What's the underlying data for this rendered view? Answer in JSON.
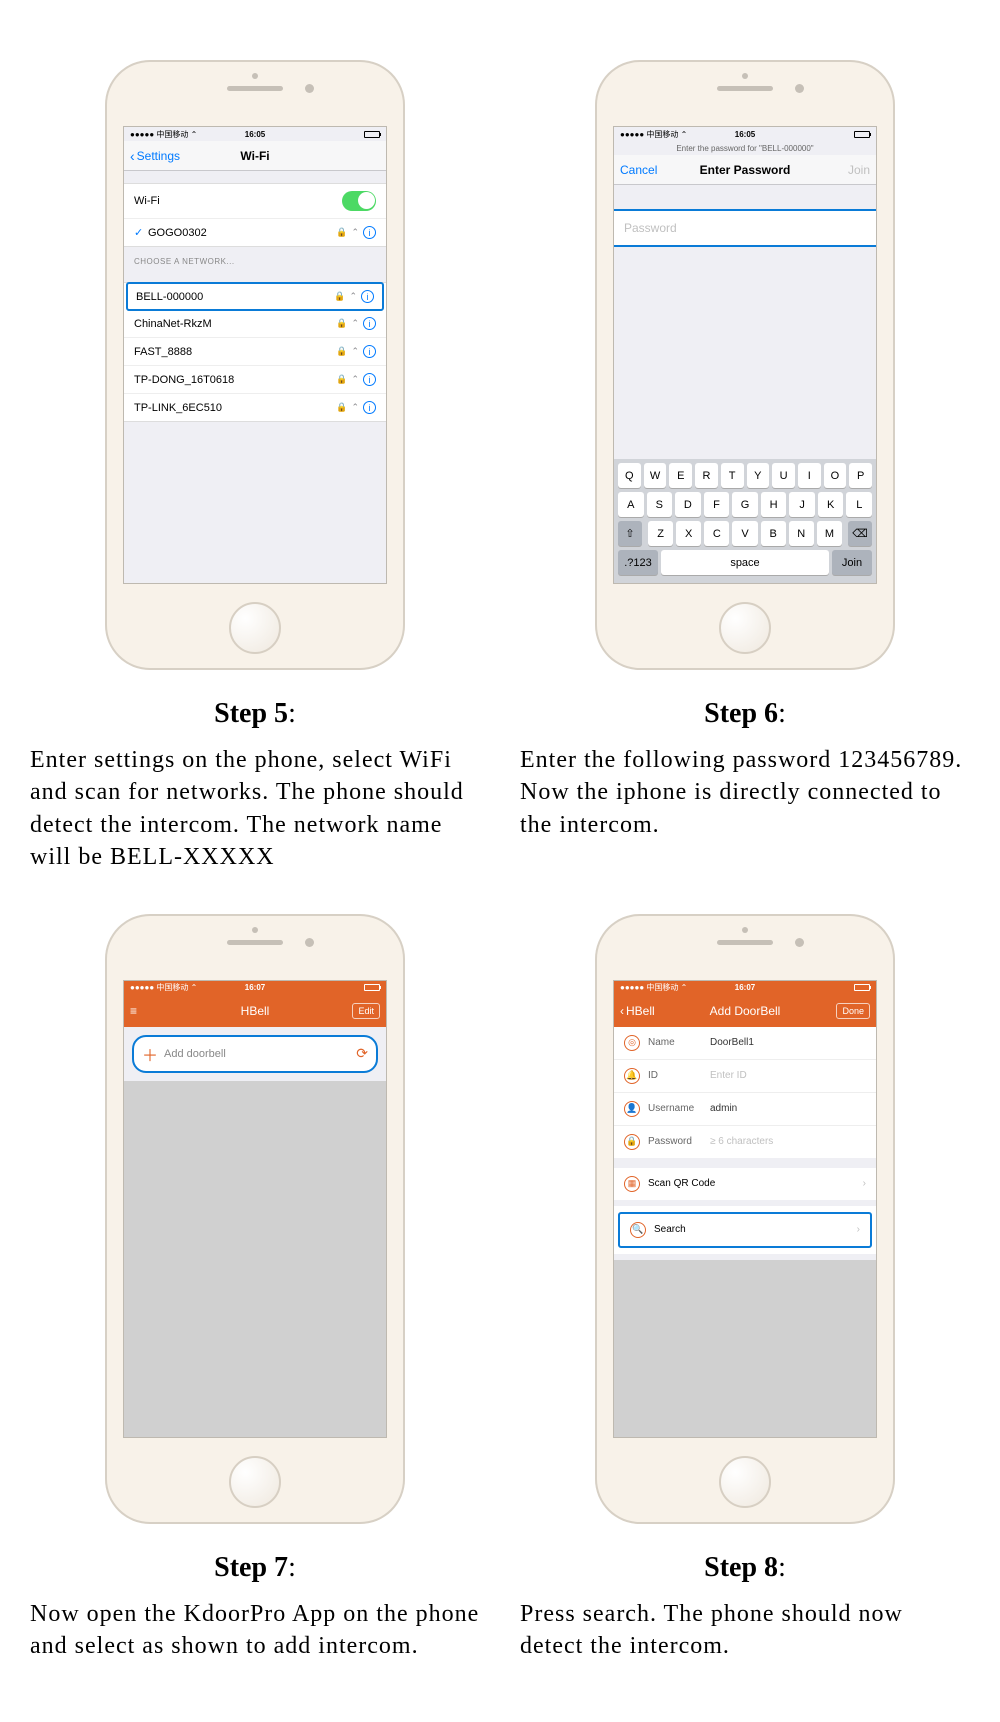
{
  "steps": {
    "s5": {
      "title": "Step 5",
      "text": "Enter settings on the phone, select WiFi and scan for networks. The phone should detect the intercom. The network name will be BELL-XXXXX"
    },
    "s6": {
      "title": "Step 6",
      "text": "Enter the following password 123456789. Now the iphone is directly connected to the intercom."
    },
    "s7": {
      "title": "Step 7",
      "text": "Now open the KdoorPro App on the phone and select as shown to add intercom."
    },
    "s8": {
      "title": "Step 8",
      "text": "Press search. The phone should now detect the intercom."
    }
  },
  "phone5": {
    "carrier": "●●●●● 中国移动 ⌃",
    "time": "16:05",
    "back": "Settings",
    "title": "Wi-Fi",
    "wifi_label": "Wi-Fi",
    "connected": "GOGO0302",
    "choose": "CHOOSE A NETWORK...",
    "nets": [
      "BELL-000000",
      "ChinaNet-RkzM",
      "FAST_8888",
      "TP-DONG_16T0618",
      "TP-LINK_6EC510"
    ]
  },
  "phone6": {
    "carrier": "●●●●● 中国移动 ⌃",
    "time": "16:05",
    "sub": "Enter the password for \"BELL-000000\"",
    "cancel": "Cancel",
    "title": "Enter Password",
    "join": "Join",
    "placeholder": "Password",
    "row1": [
      "Q",
      "W",
      "E",
      "R",
      "T",
      "Y",
      "U",
      "I",
      "O",
      "P"
    ],
    "row2": [
      "A",
      "S",
      "D",
      "F",
      "G",
      "H",
      "J",
      "K",
      "L"
    ],
    "row3": [
      "Z",
      "X",
      "C",
      "V",
      "B",
      "N",
      "M"
    ],
    "numkey": ".?123",
    "space": "space",
    "joinkey": "Join"
  },
  "phone7": {
    "carrier": "●●●●● 中国移动 ⌃",
    "time": "16:07",
    "title": "HBell",
    "edit": "Edit",
    "add": "Add doorbell"
  },
  "phone8": {
    "carrier": "●●●●● 中国移动 ⌃",
    "time": "16:07",
    "back": "HBell",
    "title": "Add DoorBell",
    "done": "Done",
    "f_name": "Name",
    "v_name": "DoorBell1",
    "f_id": "ID",
    "v_id": "Enter ID",
    "f_user": "Username",
    "v_user": "admin",
    "f_pass": "Password",
    "v_pass": "≥ 6 characters",
    "scan": "Scan QR Code",
    "search": "Search"
  }
}
